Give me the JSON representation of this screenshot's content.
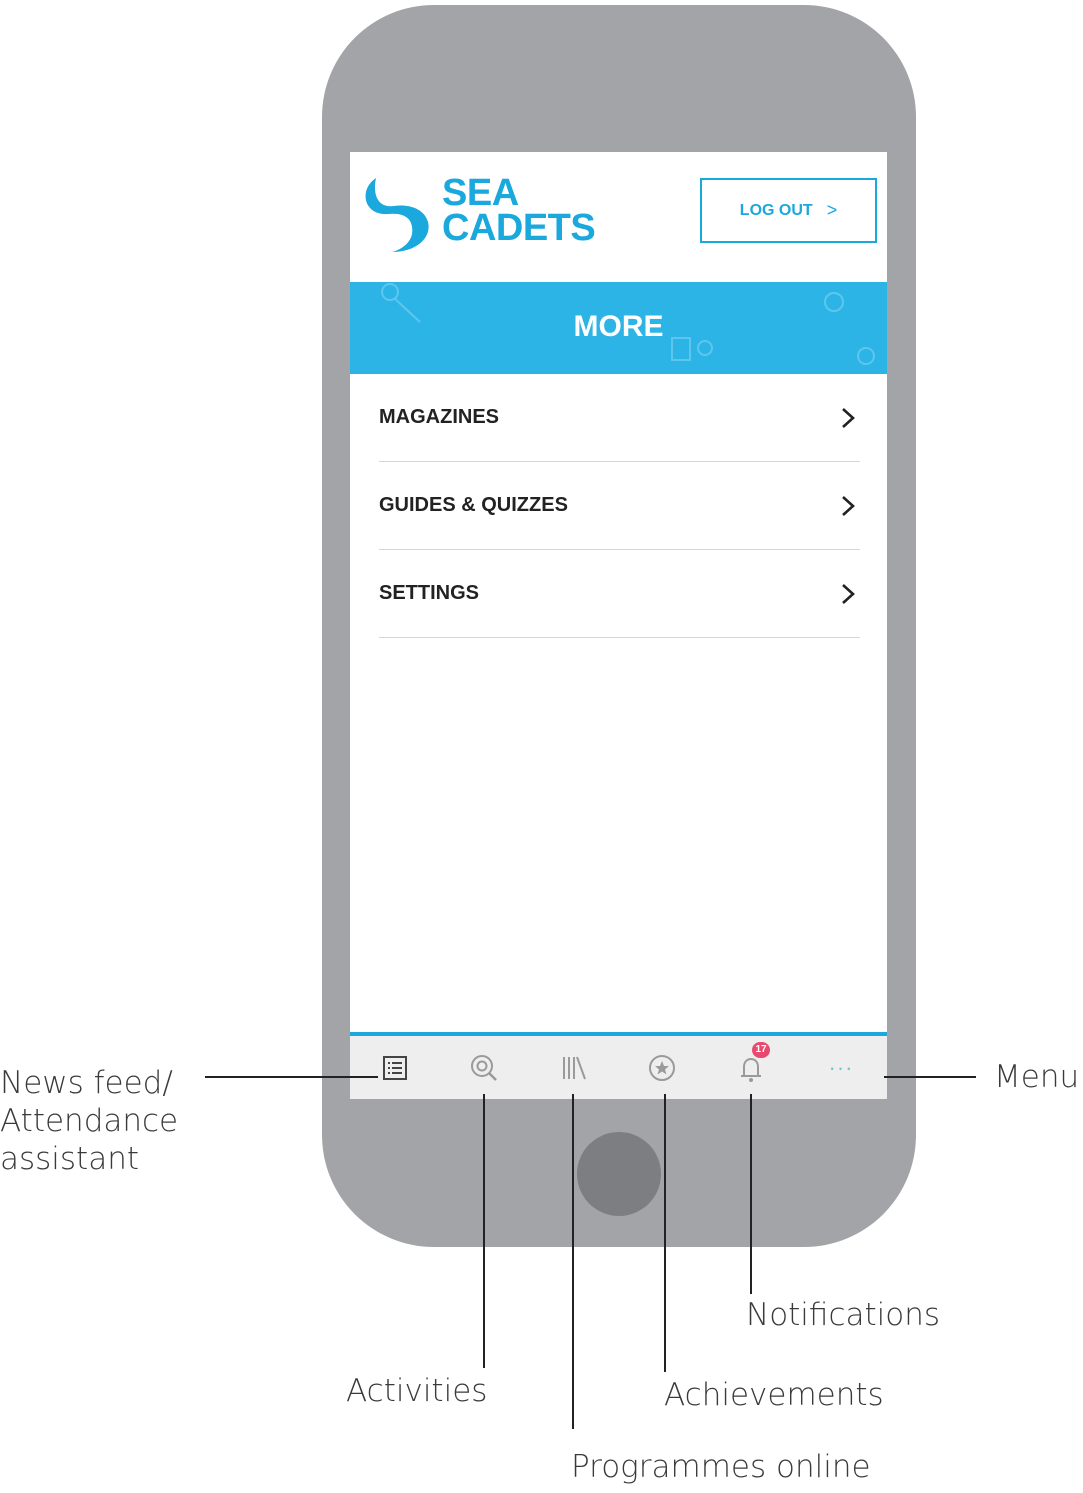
{
  "header": {
    "logo_line1": "SEA",
    "logo_line2": "CADETS",
    "logout_label": "LOG OUT",
    "logout_chevron": ">"
  },
  "banner": {
    "title": "MORE"
  },
  "menu": {
    "items": [
      {
        "label": "MAGAZINES"
      },
      {
        "label": "GUIDES & QUIZZES"
      },
      {
        "label": "SETTINGS"
      }
    ]
  },
  "tabbar": {
    "tabs": [
      {
        "icon": "news-feed-icon"
      },
      {
        "icon": "activities-icon"
      },
      {
        "icon": "programmes-icon"
      },
      {
        "icon": "achievements-icon"
      },
      {
        "icon": "notifications-icon",
        "badge": "17"
      },
      {
        "icon": "menu-dots-icon",
        "label": "···"
      }
    ]
  },
  "annotations": {
    "news_feed_line1": "News feed/",
    "news_feed_line2": "Attendance",
    "news_feed_line3": "assistant",
    "menu": "Menu",
    "notifications": "Notifications",
    "activities": "Activities",
    "achievements": "Achievements",
    "programmes": "Programmes online"
  },
  "colors": {
    "brand_blue": "#1aa8dd",
    "banner_blue": "#2db4e6",
    "phone_gray": "#a3a4a7",
    "badge_pink": "#e84a6f",
    "menu_dots_teal": "#5fd0c4"
  }
}
